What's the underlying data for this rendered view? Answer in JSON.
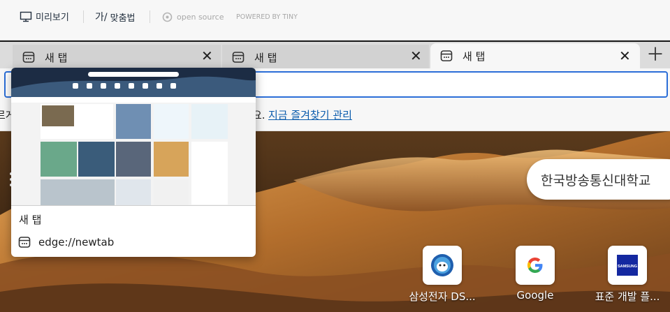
{
  "editor_toolbar": {
    "preview_label": "미리보기",
    "spellcheck_label": "맞춤법",
    "open_source_label": "open source",
    "powered_by_label": "POWERED BY TINY"
  },
  "tabs": [
    {
      "title": "새 탭",
      "active": false
    },
    {
      "title": "새 탭",
      "active": false
    },
    {
      "title": "새 탭",
      "active": true
    }
  ],
  "favorites_bar": {
    "left_fragment": "르게",
    "message_fragment": "요.",
    "manage_link": "지금 즐겨찾기 관리"
  },
  "new_tab_page": {
    "search_text": "한국방송통신대학교",
    "quick_links": [
      {
        "label": "삼성전자 DS...",
        "icon": "samsung-ds-icon"
      },
      {
        "label": "Google",
        "icon": "google-icon"
      },
      {
        "label": "표준 개발 플...",
        "icon": "samsung-logo-icon"
      }
    ]
  },
  "hover_card": {
    "title": "새 탭",
    "url": "edge://newtab"
  },
  "colors": {
    "accent": "#2b6ed8",
    "link": "#0b5cad",
    "tab_active": "#f7f7f7",
    "tab_inactive": "#d2d2d2"
  }
}
